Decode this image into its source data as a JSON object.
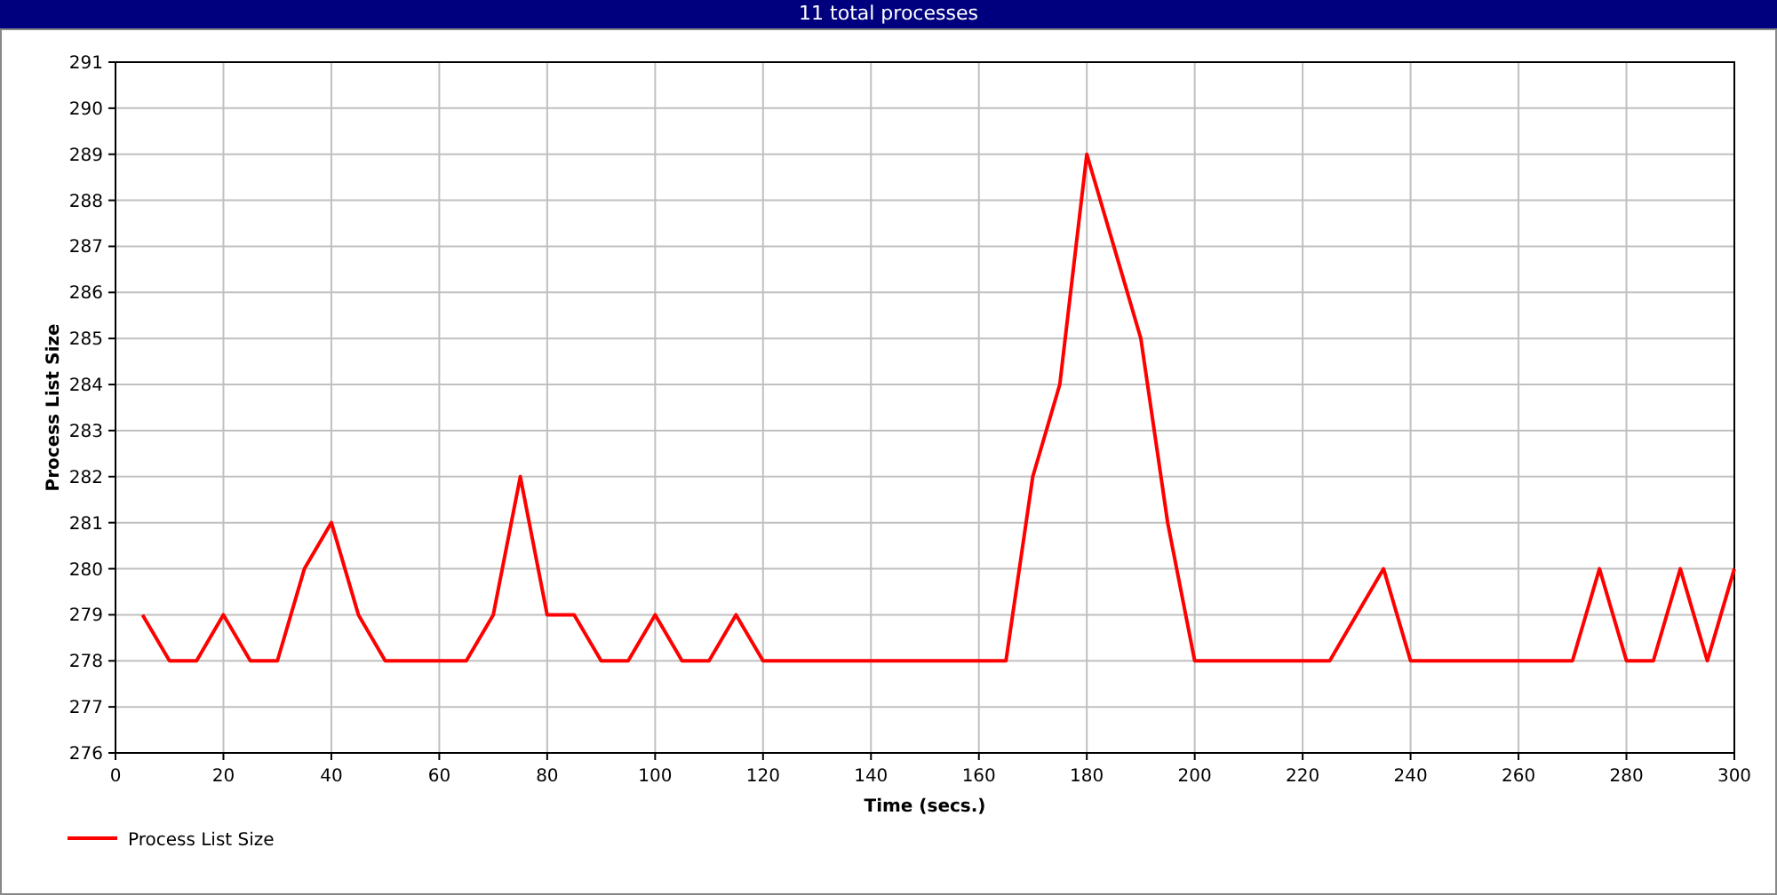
{
  "title": "11 total processes",
  "chart_data": {
    "type": "line",
    "xlabel": "Time (secs.)",
    "ylabel": "Process List Size",
    "x": [
      5,
      10,
      15,
      20,
      25,
      30,
      35,
      40,
      45,
      50,
      55,
      60,
      65,
      70,
      75,
      80,
      85,
      90,
      95,
      100,
      105,
      110,
      115,
      120,
      125,
      130,
      135,
      140,
      145,
      150,
      155,
      160,
      165,
      170,
      175,
      180,
      185,
      190,
      195,
      200,
      205,
      210,
      215,
      220,
      225,
      230,
      235,
      240,
      245,
      250,
      255,
      260,
      265,
      270,
      275,
      280,
      285,
      290,
      295,
      300
    ],
    "series": [
      {
        "name": "Process List Size",
        "color": "#ff0000",
        "values": [
          279,
          278,
          278,
          279,
          278,
          278,
          280,
          281,
          279,
          278,
          278,
          278,
          278,
          279,
          282,
          279,
          279,
          278,
          278,
          279,
          278,
          278,
          279,
          278,
          278,
          278,
          278,
          278,
          278,
          278,
          278,
          278,
          278,
          282,
          284,
          289,
          287,
          285,
          281,
          278,
          278,
          278,
          278,
          278,
          278,
          279,
          280,
          278,
          278,
          278,
          278,
          278,
          278,
          278,
          280,
          278,
          278,
          280,
          278,
          280
        ]
      }
    ],
    "grid": true,
    "xlim": [
      0,
      300
    ],
    "ylim": [
      276,
      291
    ],
    "xticks": [
      0,
      20,
      40,
      60,
      80,
      100,
      120,
      140,
      160,
      180,
      200,
      220,
      240,
      260,
      280,
      300
    ],
    "yticks": [
      276,
      277,
      278,
      279,
      280,
      281,
      282,
      283,
      284,
      285,
      286,
      287,
      288,
      289,
      290,
      291
    ]
  }
}
